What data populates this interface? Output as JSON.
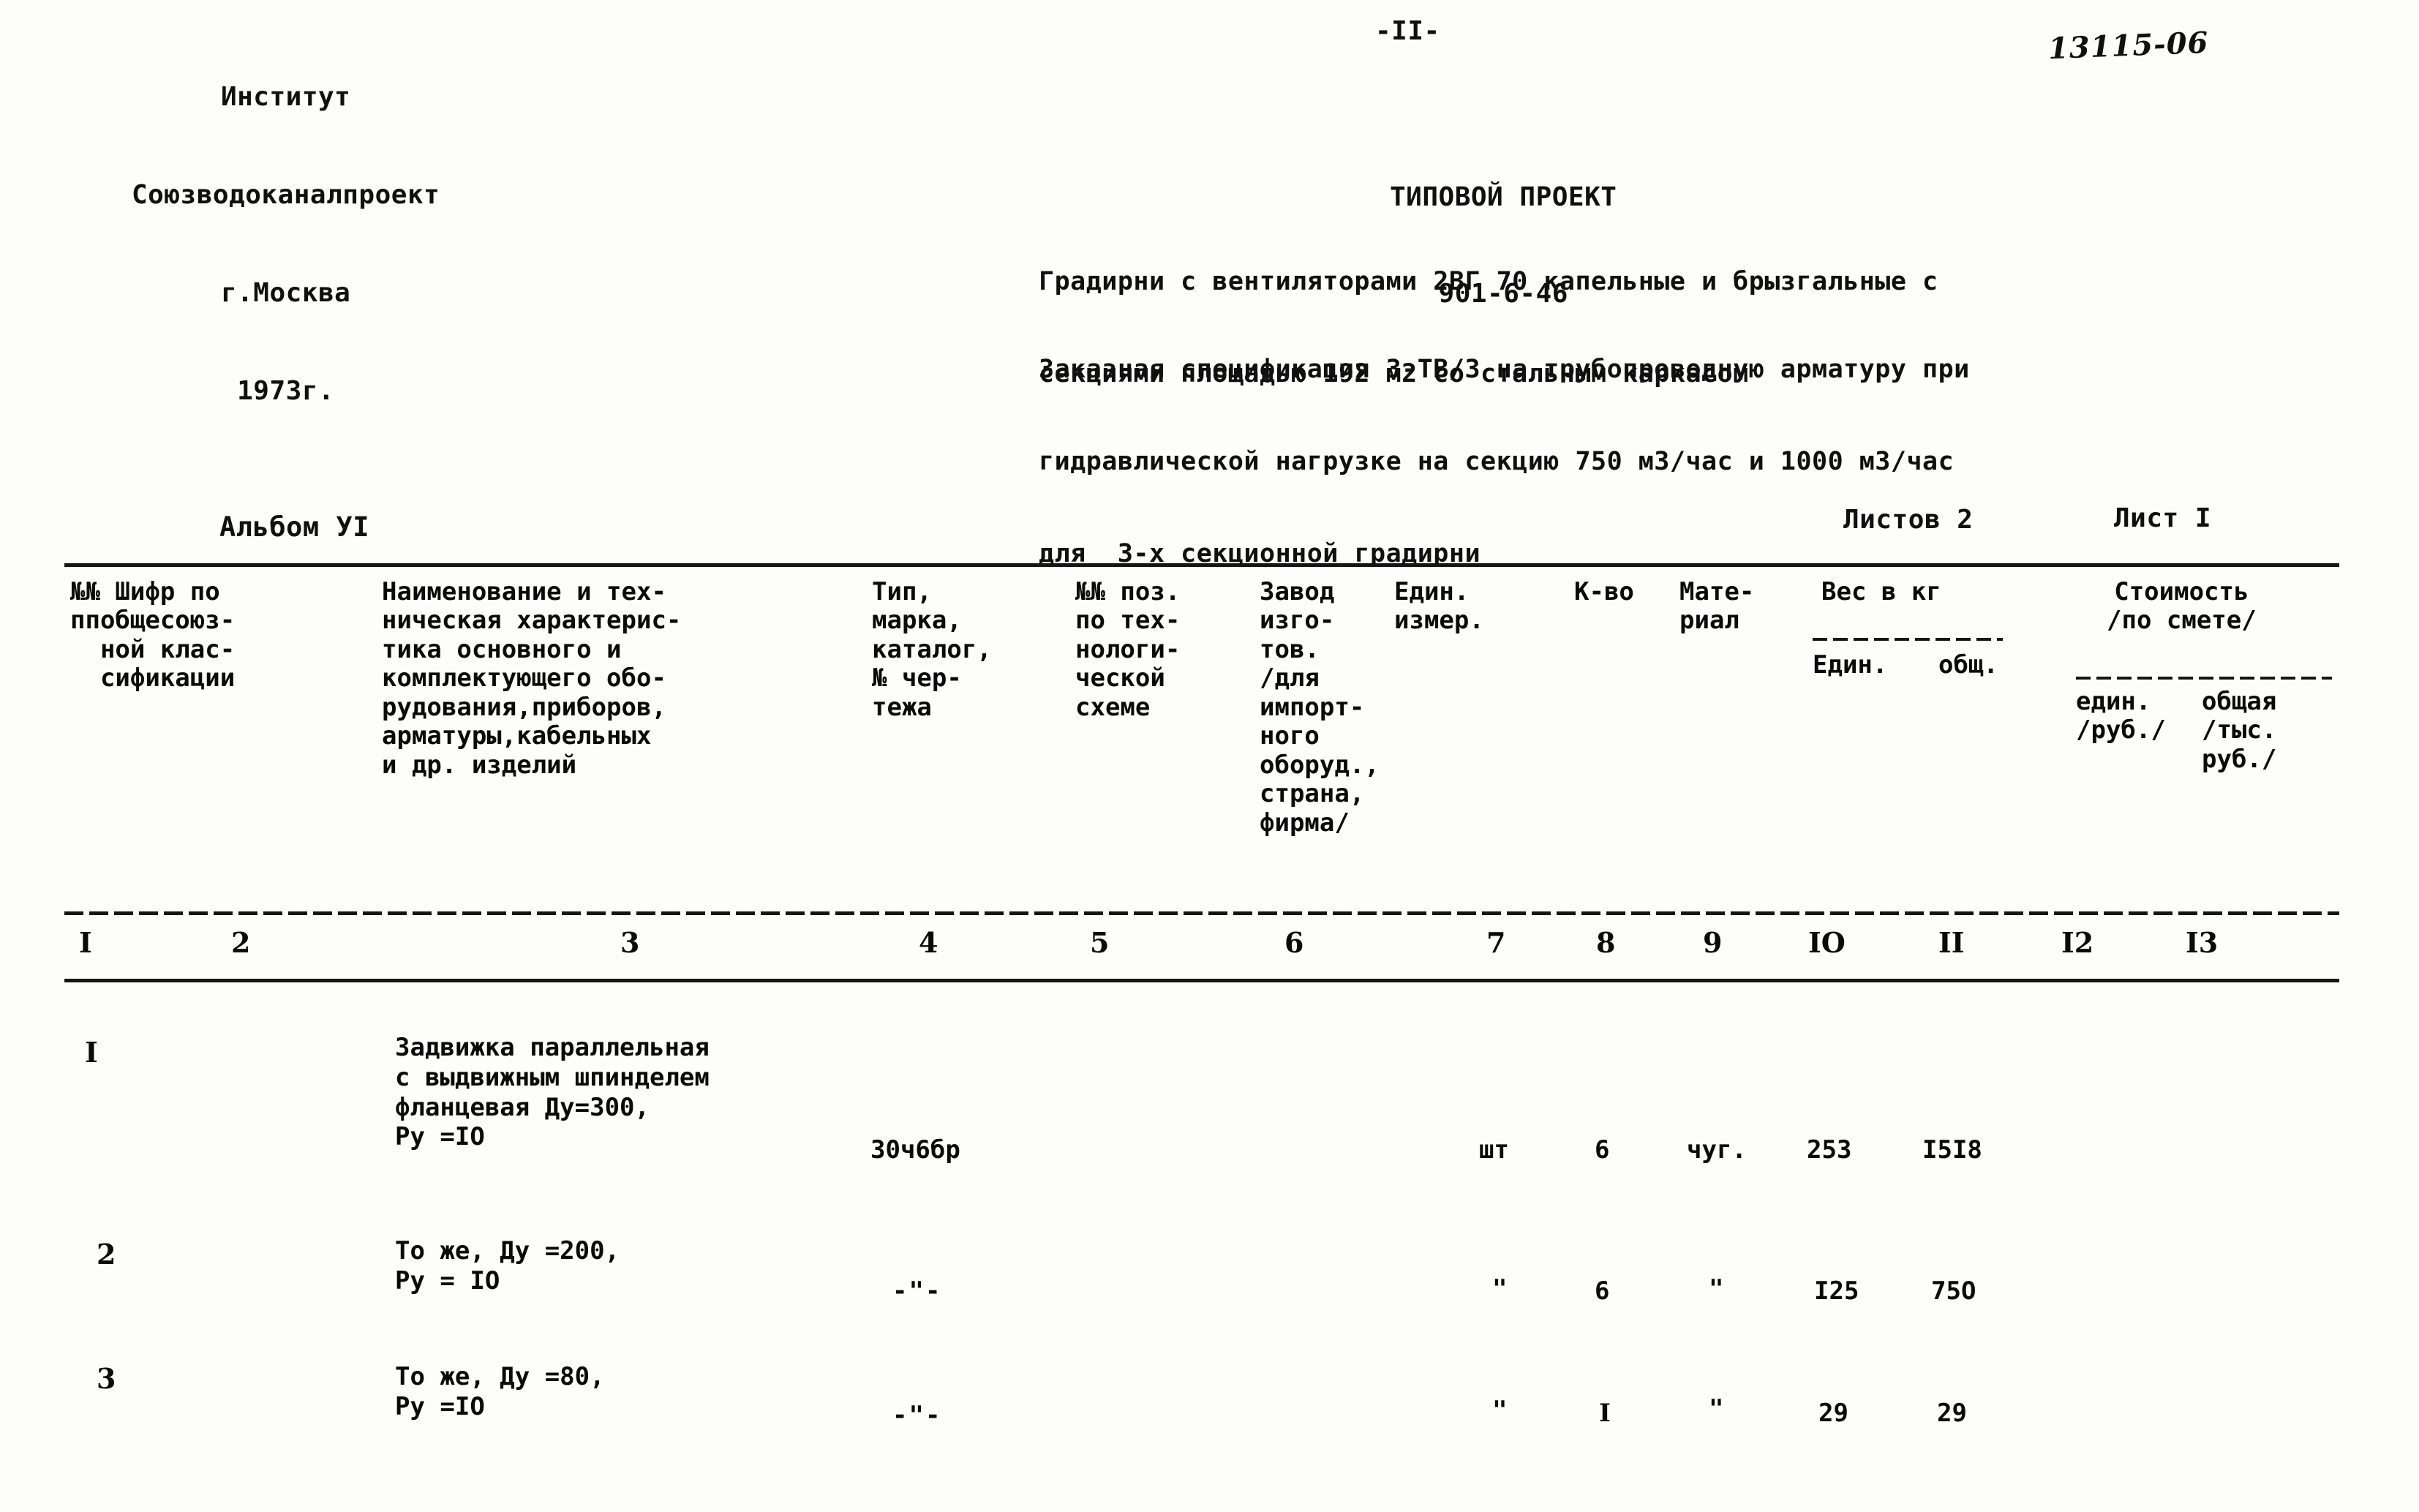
{
  "header": {
    "organization": [
      "Институт",
      "Союзводоканалпроект",
      "г.Москва",
      "1973г."
    ],
    "page_number": "-II-",
    "doc_code": "13115-06",
    "project_label": "ТИПОВОЙ ПРОЕКТ",
    "project_number": "901-6-46",
    "subject_lines": [
      "Градирни с вентиляторами 2ВГ 70 капельные и брызгальные с",
      "секциями площадью 192 м2 со стальным каркасом"
    ],
    "spec_lines": [
      "Заказная спецификация 3-ТВ/3 на трубопроводную арматуру при",
      "гидравлической нагрузке на секцию 750 м3/час и 1000 м3/час",
      "для  3-х секционной градирни"
    ]
  },
  "sheet": {
    "album_label": "Альбом УI",
    "sheets_total": "Листов 2",
    "sheet_current": "Лист I"
  },
  "table": {
    "headers": {
      "col1": "№№ Шифр по\nппобщесоюз-\n  ной клас-\n  сификации",
      "col3": "Наименование и тех-\nническая характерис-\nтика основного и\nкомплектующего обо-\nрудования,приборов,\nарматуры,кабельных\nи др. изделий",
      "col4": "Тип,\nмарка,\nкаталог,\n№ чер-\nтежа",
      "col5": "№№ поз.\nпо тех-\nнологи-\nческой\nсхеме",
      "col6": "Завод\nизго-\nтов.\n/для\nимпорт-\nного\nоборуд.,\nстрана,\nфирма/",
      "col7": "Един.\nизмер.",
      "col8": "К-во",
      "col9": "Мате-\nриал",
      "col10_group": "Вес в кг",
      "col10": "Един.",
      "col11": "общ.",
      "cost_group": "Стоимость\n/по смете/",
      "col12": "един.\n/руб./",
      "col13": "общая\n/тыс.\nруб./"
    },
    "column_numbers": [
      "I",
      "2",
      "3",
      "4",
      "5",
      "6",
      "7",
      "8",
      "9",
      "IO",
      "II",
      "I2",
      "I3"
    ],
    "rows": [
      {
        "num": "I",
        "name": "Задвижка параллельная\nс выдвижным шпинделем\nфланцевая Ду=300,\nРу =IO",
        "type": "30ч6бр",
        "pos": "",
        "plant": "",
        "unit": "шт",
        "qty": "6",
        "material": "чуг.",
        "weight_unit": "253",
        "weight_total": "I5I8",
        "cost_unit": "",
        "cost_total": ""
      },
      {
        "num": "2",
        "name": "То же, Ду =200,\nРу = IO",
        "type": "-\"-",
        "pos": "",
        "plant": "",
        "unit": "\"",
        "qty": "6",
        "material": "\"",
        "weight_unit": "I25",
        "weight_total": "75O",
        "cost_unit": "",
        "cost_total": ""
      },
      {
        "num": "3",
        "name": "То же, Ду =80,\nРу =IO",
        "type": "-\"-",
        "pos": "",
        "plant": "",
        "unit": "\"",
        "qty": "I",
        "material": "\"",
        "weight_unit": "29",
        "weight_total": "29",
        "cost_unit": "",
        "cost_total": ""
      }
    ]
  }
}
